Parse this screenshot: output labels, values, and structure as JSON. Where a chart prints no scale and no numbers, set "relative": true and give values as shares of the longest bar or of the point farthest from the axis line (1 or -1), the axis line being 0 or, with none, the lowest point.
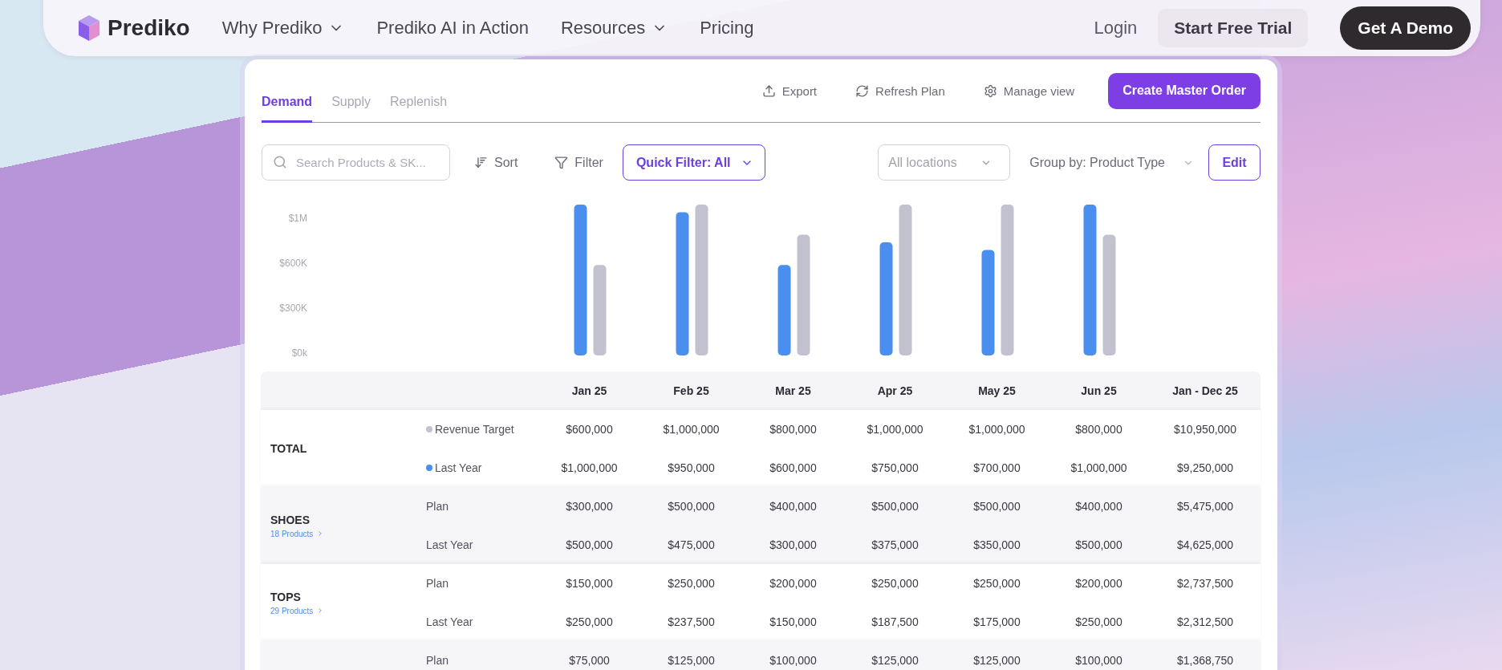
{
  "nav": {
    "logo": "Prediko",
    "links": [
      {
        "label": "Why Prediko",
        "dropdown": true
      },
      {
        "label": "Prediko AI in Action",
        "dropdown": false
      },
      {
        "label": "Resources",
        "dropdown": true
      },
      {
        "label": "Pricing",
        "dropdown": false
      }
    ],
    "login": "Login",
    "trial": "Start Free Trial",
    "demo": "Get A Demo"
  },
  "tabs": [
    {
      "label": "Demand",
      "selected": true
    },
    {
      "label": "Supply",
      "selected": false
    },
    {
      "label": "Replenish",
      "selected": false
    }
  ],
  "actions": [
    {
      "label": "Export",
      "kind": "export"
    },
    {
      "label": "Refresh Plan",
      "kind": "refresh"
    },
    {
      "label": "Manage view",
      "kind": "gear"
    }
  ],
  "primary_button": "Create Master Order",
  "toolbar": {
    "search_placeholder": "Search Products & SK...",
    "sort": "Sort",
    "filter": "Filter",
    "quick_filter": "Quick Filter: All",
    "locations": "All locations",
    "group_by": "Group by: Product Type",
    "edit": "Edit"
  },
  "y_axis_labels": [
    "$1M",
    "$600K",
    "$300K",
    "$0k"
  ],
  "chart_data": {
    "type": "bar",
    "relative": true,
    "categories": [
      "Jan 25",
      "Feb 25",
      "Mar 25",
      "Apr 25",
      "May 25",
      "Jun 25"
    ],
    "series": [
      {
        "color": "#4a8ff0",
        "values": [
          1,
          0.95,
          0.6,
          0.75,
          0.7,
          1
        ]
      },
      {
        "color": "#c2c1cf",
        "values": [
          0.6,
          1,
          0.8,
          1,
          1,
          0.8
        ]
      }
    ]
  },
  "table": {
    "columns": [
      "Jan - Dec 25"
    ],
    "groups": [
      {
        "name": "TOTAL",
        "rows": [
          {
            "label": "Revenue Target",
            "color": "#c2c1cf",
            "values": [
              "$600,000",
              "$1,000,000",
              "$800,000",
              "$1,000,000",
              "$1,000,000",
              "$800,000",
              "$10,950,000"
            ]
          },
          {
            "label": "Last Year",
            "color": "#4a8ff0",
            "values": [
              "$1,000,000",
              "$950,000",
              "$600,000",
              "$750,000",
              "$700,000",
              "$1,000,000",
              "$9,250,000"
            ]
          }
        ]
      },
      {
        "name": "SHOES",
        "link": "18 Products",
        "rows": [
          {
            "label": "Plan",
            "values": [
              "$300,000",
              "$500,000",
              "$400,000",
              "$500,000",
              "$500,000",
              "$400,000",
              "$5,475,000"
            ]
          },
          {
            "label": "Last Year",
            "values": [
              "$500,000",
              "$475,000",
              "$300,000",
              "$375,000",
              "$350,000",
              "$500,000",
              "$4,625,000"
            ]
          }
        ]
      },
      {
        "name": "TOPS",
        "link": "29 Products",
        "rows": [
          {
            "label": "Plan",
            "values": [
              "$150,000",
              "$250,000",
              "$200,000",
              "$250,000",
              "$250,000",
              "$200,000",
              "$2,737,500"
            ]
          },
          {
            "label": "Last Year",
            "values": [
              "$250,000",
              "$237,500",
              "$150,000",
              "$187,500",
              "$175,000",
              "$250,000",
              "$2,312,500"
            ]
          }
        ]
      },
      {
        "rows": [
          {
            "label": "Plan",
            "values": [
              "$75,000",
              "$125,000",
              "$100,000",
              "$125,000",
              "$125,000",
              "$100,000",
              "$1,368,750"
            ]
          }
        ]
      }
    ]
  }
}
